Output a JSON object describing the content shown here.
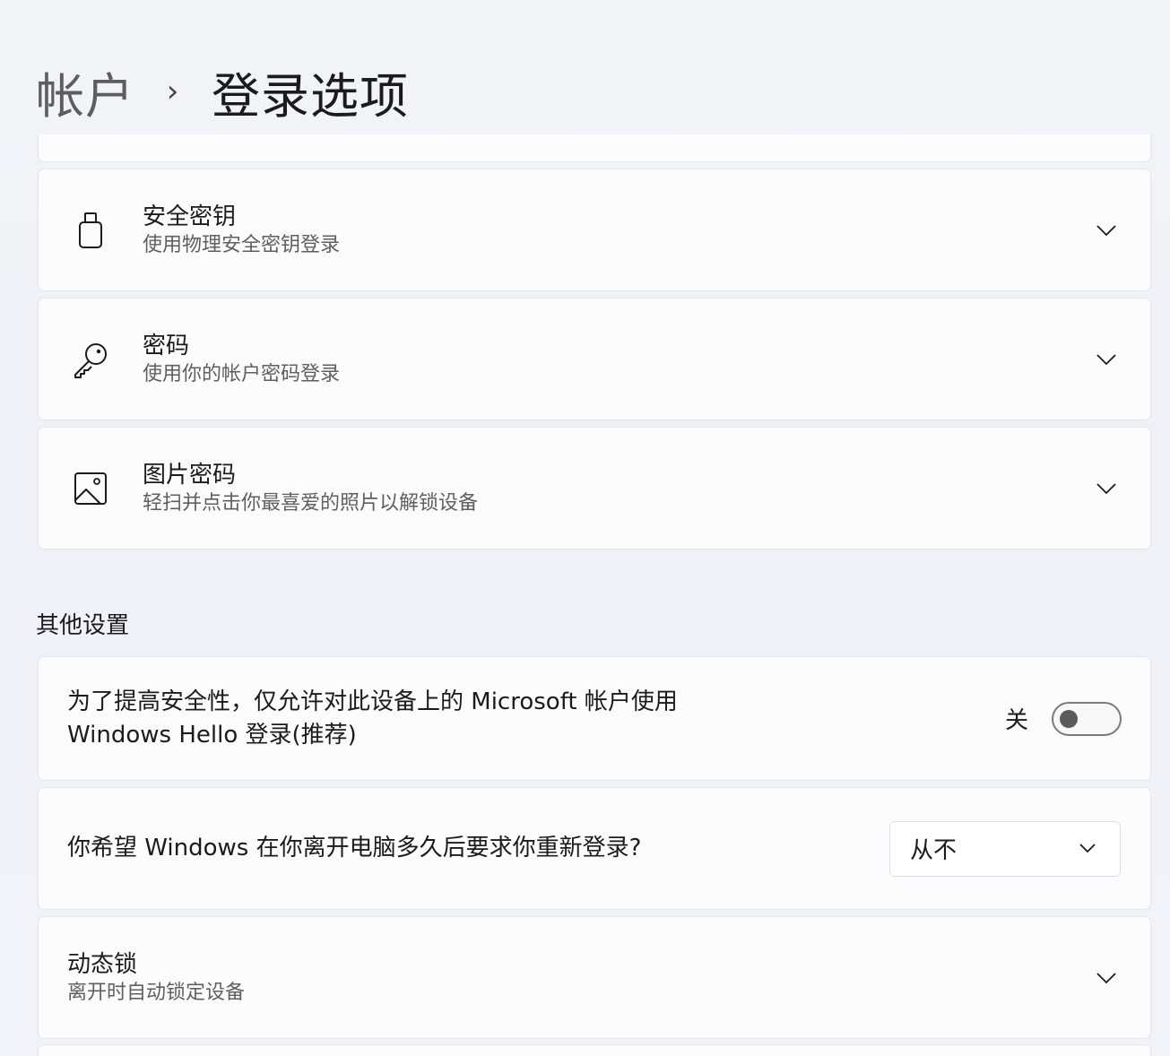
{
  "breadcrumb": {
    "parent": "帐户",
    "separator": "›",
    "current": "登录选项"
  },
  "sign_in_methods": [
    {
      "title": "安全密钥",
      "subtitle": "使用物理安全密钥登录",
      "icon": "usb-key-icon"
    },
    {
      "title": "密码",
      "subtitle": "使用你的帐户密码登录",
      "icon": "key-icon"
    },
    {
      "title": "图片密码",
      "subtitle": "轻扫并点击你最喜爱的照片以解锁设备",
      "icon": "picture-icon"
    }
  ],
  "other_settings": {
    "heading": "其他设置",
    "hello_only": {
      "line1": "为了提高安全性，仅允许对此设备上的 Microsoft 帐户使用",
      "line2": "Windows Hello 登录(推荐)",
      "toggle_state_label": "关",
      "toggle_on": false
    },
    "require_signin": {
      "question": "你希望 Windows 在你离开电脑多久后要求你重新登录?",
      "selected": "从不"
    },
    "dynamic_lock": {
      "title": "动态锁",
      "subtitle": "离开时自动锁定设备"
    }
  }
}
